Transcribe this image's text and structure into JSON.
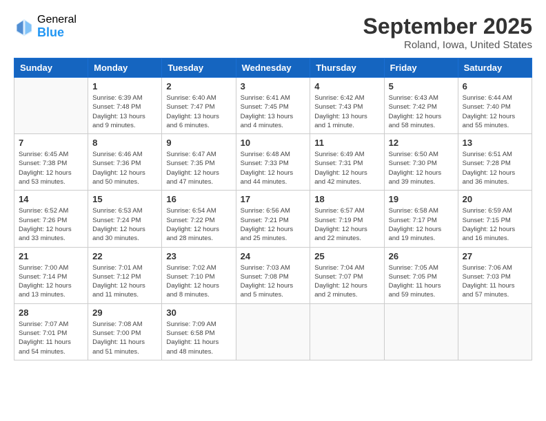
{
  "header": {
    "logo_general": "General",
    "logo_blue": "Blue",
    "month_year": "September 2025",
    "location": "Roland, Iowa, United States"
  },
  "days_of_week": [
    "Sunday",
    "Monday",
    "Tuesday",
    "Wednesday",
    "Thursday",
    "Friday",
    "Saturday"
  ],
  "weeks": [
    [
      {
        "day": "",
        "info": ""
      },
      {
        "day": "1",
        "info": "Sunrise: 6:39 AM\nSunset: 7:48 PM\nDaylight: 13 hours\nand 9 minutes."
      },
      {
        "day": "2",
        "info": "Sunrise: 6:40 AM\nSunset: 7:47 PM\nDaylight: 13 hours\nand 6 minutes."
      },
      {
        "day": "3",
        "info": "Sunrise: 6:41 AM\nSunset: 7:45 PM\nDaylight: 13 hours\nand 4 minutes."
      },
      {
        "day": "4",
        "info": "Sunrise: 6:42 AM\nSunset: 7:43 PM\nDaylight: 13 hours\nand 1 minute."
      },
      {
        "day": "5",
        "info": "Sunrise: 6:43 AM\nSunset: 7:42 PM\nDaylight: 12 hours\nand 58 minutes."
      },
      {
        "day": "6",
        "info": "Sunrise: 6:44 AM\nSunset: 7:40 PM\nDaylight: 12 hours\nand 55 minutes."
      }
    ],
    [
      {
        "day": "7",
        "info": "Sunrise: 6:45 AM\nSunset: 7:38 PM\nDaylight: 12 hours\nand 53 minutes."
      },
      {
        "day": "8",
        "info": "Sunrise: 6:46 AM\nSunset: 7:36 PM\nDaylight: 12 hours\nand 50 minutes."
      },
      {
        "day": "9",
        "info": "Sunrise: 6:47 AM\nSunset: 7:35 PM\nDaylight: 12 hours\nand 47 minutes."
      },
      {
        "day": "10",
        "info": "Sunrise: 6:48 AM\nSunset: 7:33 PM\nDaylight: 12 hours\nand 44 minutes."
      },
      {
        "day": "11",
        "info": "Sunrise: 6:49 AM\nSunset: 7:31 PM\nDaylight: 12 hours\nand 42 minutes."
      },
      {
        "day": "12",
        "info": "Sunrise: 6:50 AM\nSunset: 7:30 PM\nDaylight: 12 hours\nand 39 minutes."
      },
      {
        "day": "13",
        "info": "Sunrise: 6:51 AM\nSunset: 7:28 PM\nDaylight: 12 hours\nand 36 minutes."
      }
    ],
    [
      {
        "day": "14",
        "info": "Sunrise: 6:52 AM\nSunset: 7:26 PM\nDaylight: 12 hours\nand 33 minutes."
      },
      {
        "day": "15",
        "info": "Sunrise: 6:53 AM\nSunset: 7:24 PM\nDaylight: 12 hours\nand 30 minutes."
      },
      {
        "day": "16",
        "info": "Sunrise: 6:54 AM\nSunset: 7:22 PM\nDaylight: 12 hours\nand 28 minutes."
      },
      {
        "day": "17",
        "info": "Sunrise: 6:56 AM\nSunset: 7:21 PM\nDaylight: 12 hours\nand 25 minutes."
      },
      {
        "day": "18",
        "info": "Sunrise: 6:57 AM\nSunset: 7:19 PM\nDaylight: 12 hours\nand 22 minutes."
      },
      {
        "day": "19",
        "info": "Sunrise: 6:58 AM\nSunset: 7:17 PM\nDaylight: 12 hours\nand 19 minutes."
      },
      {
        "day": "20",
        "info": "Sunrise: 6:59 AM\nSunset: 7:15 PM\nDaylight: 12 hours\nand 16 minutes."
      }
    ],
    [
      {
        "day": "21",
        "info": "Sunrise: 7:00 AM\nSunset: 7:14 PM\nDaylight: 12 hours\nand 13 minutes."
      },
      {
        "day": "22",
        "info": "Sunrise: 7:01 AM\nSunset: 7:12 PM\nDaylight: 12 hours\nand 11 minutes."
      },
      {
        "day": "23",
        "info": "Sunrise: 7:02 AM\nSunset: 7:10 PM\nDaylight: 12 hours\nand 8 minutes."
      },
      {
        "day": "24",
        "info": "Sunrise: 7:03 AM\nSunset: 7:08 PM\nDaylight: 12 hours\nand 5 minutes."
      },
      {
        "day": "25",
        "info": "Sunrise: 7:04 AM\nSunset: 7:07 PM\nDaylight: 12 hours\nand 2 minutes."
      },
      {
        "day": "26",
        "info": "Sunrise: 7:05 AM\nSunset: 7:05 PM\nDaylight: 11 hours\nand 59 minutes."
      },
      {
        "day": "27",
        "info": "Sunrise: 7:06 AM\nSunset: 7:03 PM\nDaylight: 11 hours\nand 57 minutes."
      }
    ],
    [
      {
        "day": "28",
        "info": "Sunrise: 7:07 AM\nSunset: 7:01 PM\nDaylight: 11 hours\nand 54 minutes."
      },
      {
        "day": "29",
        "info": "Sunrise: 7:08 AM\nSunset: 7:00 PM\nDaylight: 11 hours\nand 51 minutes."
      },
      {
        "day": "30",
        "info": "Sunrise: 7:09 AM\nSunset: 6:58 PM\nDaylight: 11 hours\nand 48 minutes."
      },
      {
        "day": "",
        "info": ""
      },
      {
        "day": "",
        "info": ""
      },
      {
        "day": "",
        "info": ""
      },
      {
        "day": "",
        "info": ""
      }
    ]
  ]
}
